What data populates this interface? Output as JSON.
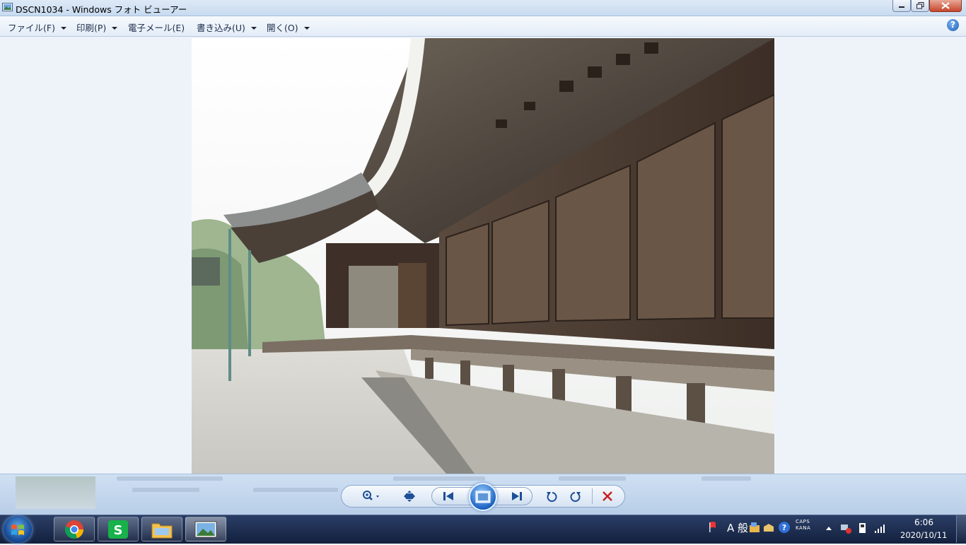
{
  "window": {
    "title": "DSCN1034 - Windows フォト ビューアー",
    "icon": "photo-viewer-icon"
  },
  "menu": {
    "file": "ファイル(F)",
    "print": "印刷(P)",
    "email": "電子メール(E)",
    "burn": "書き込み(U)",
    "open": "開く(O)",
    "help": "?"
  },
  "controls": {
    "zoom": "zoom-icon",
    "fit": "actual-size-icon",
    "prev": "previous-icon",
    "slideshow": "slideshow-icon",
    "next": "next-icon",
    "rotate_ccw": "rotate-left-icon",
    "rotate_cw": "rotate-right-icon",
    "delete": "delete-icon"
  },
  "taskbar": {
    "apps": [
      "chrome",
      "spreadsheet-S",
      "file-explorer",
      "photo-viewer"
    ],
    "ime_mode": "A 般",
    "caps_indicator": "CAPS",
    "kana_indicator": "KANA",
    "time": "6:06",
    "date": "2020/10/11"
  },
  "colors": {
    "accent": "#1b63c4",
    "delete_red": "#c8201c",
    "s_green": "#17b24a"
  }
}
